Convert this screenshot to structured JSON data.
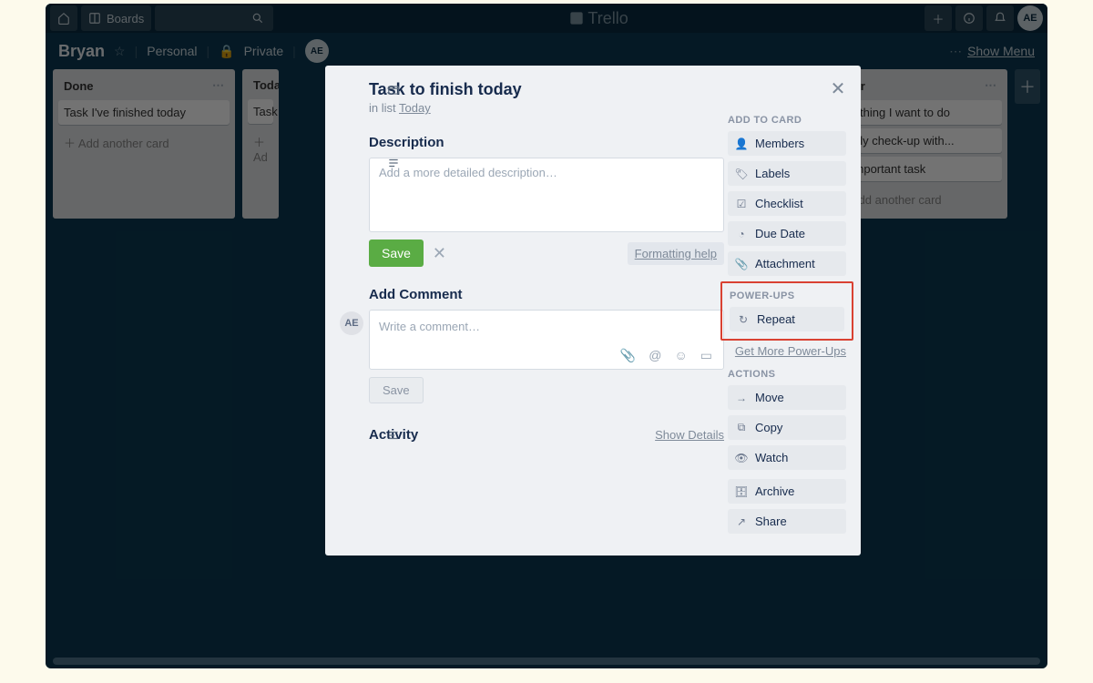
{
  "brand": "Trello",
  "header": {
    "boards_label": "Boards",
    "avatar_initials": "AE"
  },
  "board_bar": {
    "title": "Bryan",
    "visibility_team": "Personal",
    "visibility_board": "Private",
    "menu_label": "Show Menu",
    "avatar_initials": "AE"
  },
  "lists": {
    "done": {
      "title": "Done",
      "cards": [
        "Task I've finished today"
      ],
      "add": "Add another card"
    },
    "today": {
      "title": "Toda",
      "cards": [
        "Task"
      ],
      "add": "Ad"
    },
    "later": {
      "title": "Later",
      "cards": [
        "Fun thing I want to do",
        "Yearly check-up with...",
        "Unimportant task"
      ],
      "add": "Add another card"
    }
  },
  "modal": {
    "title": "Task to finish today",
    "in_list_prefix": "in list ",
    "in_list_name": "Today",
    "description_h": "Description",
    "description_ph": "Add a more detailed description…",
    "save": "Save",
    "formatting": "Formatting help",
    "comment_h": "Add Comment",
    "comment_ph": "Write a comment…",
    "comment_save": "Save",
    "activity_h": "Activity",
    "show_details": "Show Details",
    "avatar_initials": "AE"
  },
  "sidebar": {
    "add_to_card": "ADD TO CARD",
    "members": "Members",
    "labels": "Labels",
    "checklist": "Checklist",
    "due_date": "Due Date",
    "attachment": "Attachment",
    "power_ups": "POWER-UPS",
    "repeat": "Repeat",
    "get_more": "Get More Power-Ups",
    "actions": "ACTIONS",
    "move": "Move",
    "copy": "Copy",
    "watch": "Watch",
    "archive": "Archive",
    "share": "Share"
  }
}
